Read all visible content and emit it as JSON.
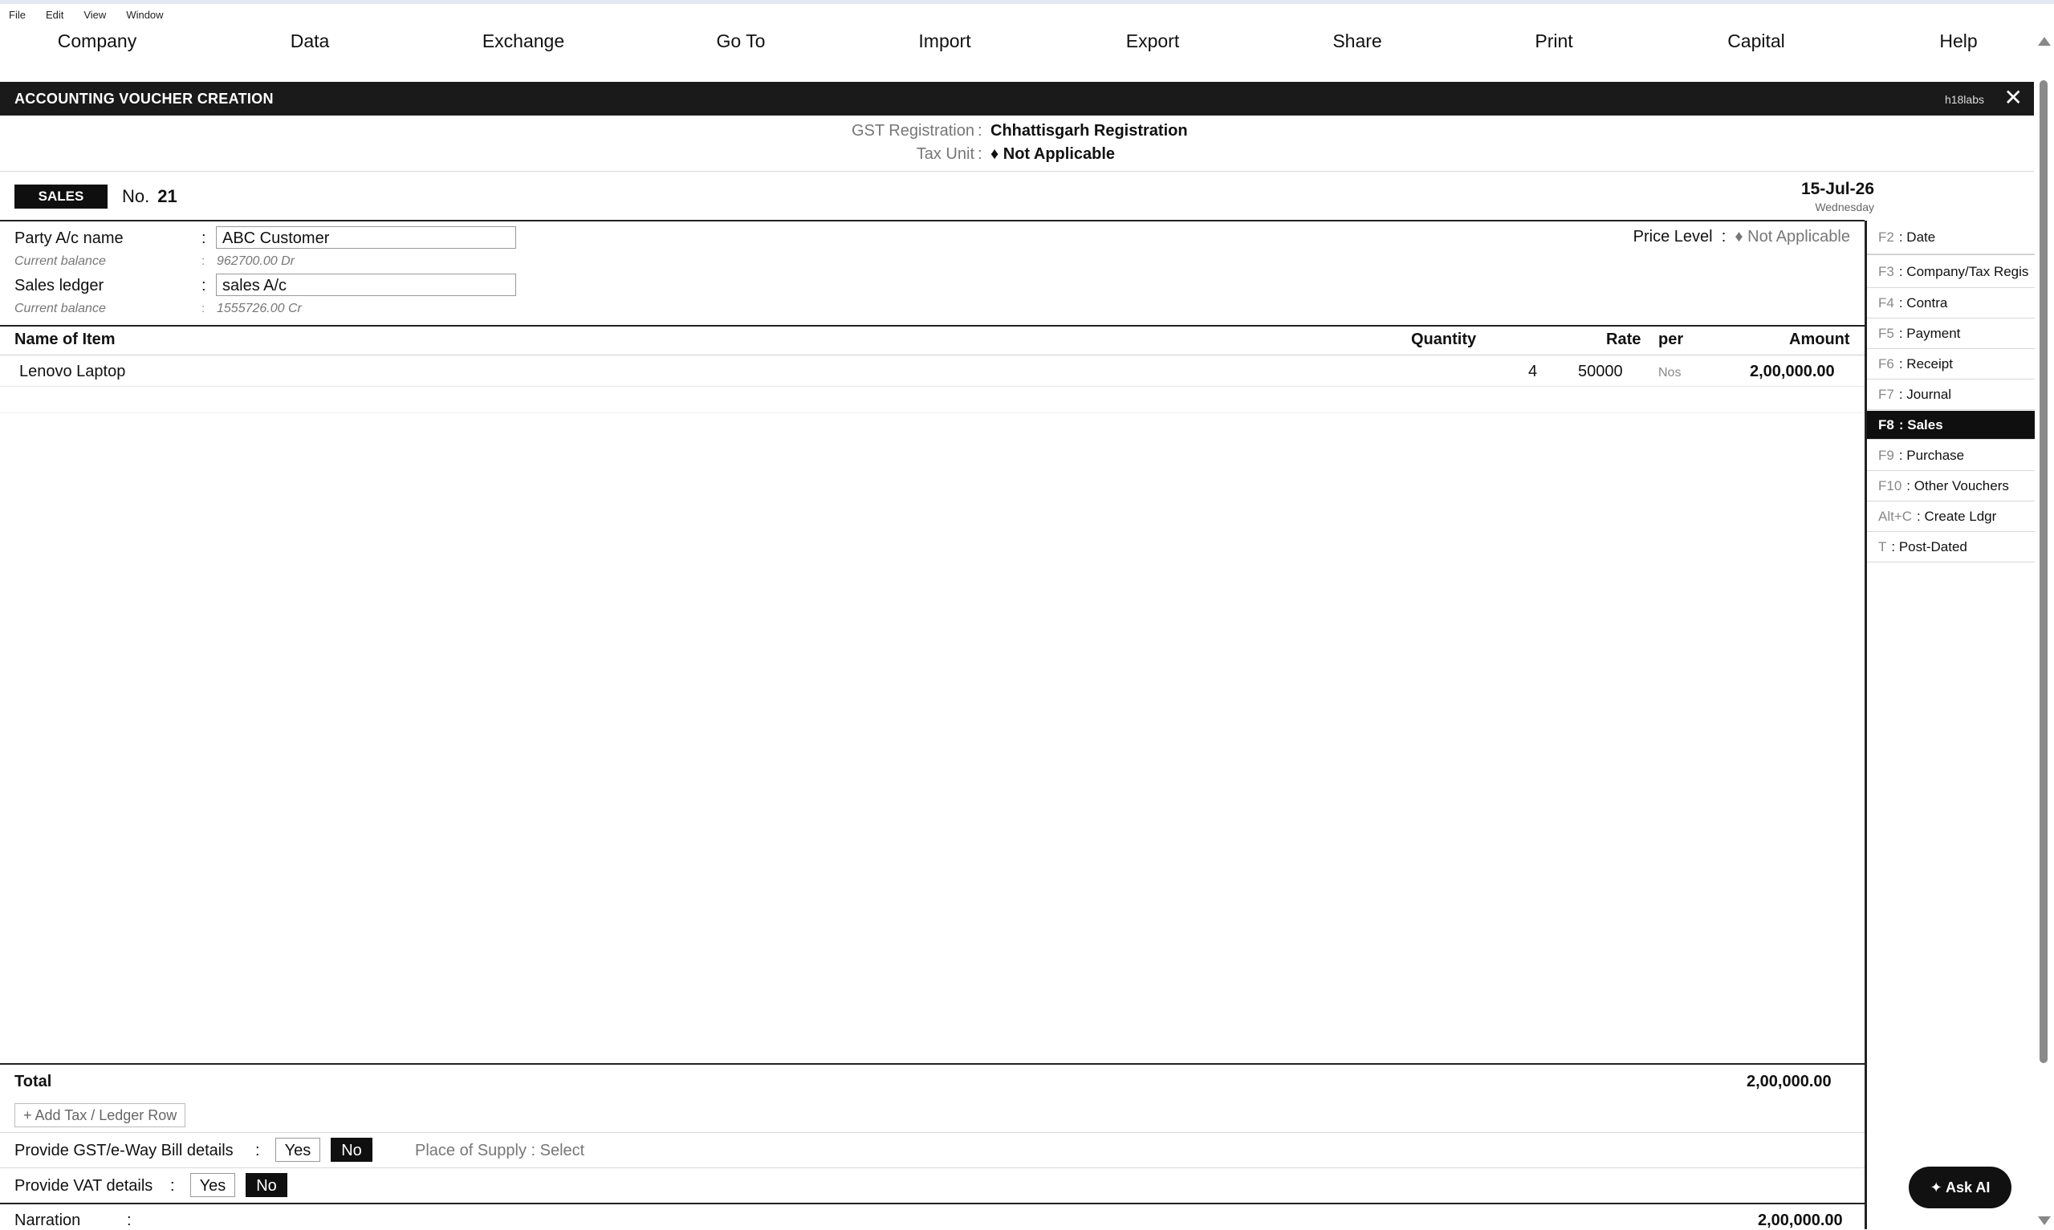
{
  "system_menu": [
    "File",
    "Edit",
    "View",
    "Window"
  ],
  "main_menu": [
    "Company",
    "Data",
    "Exchange",
    "Go To",
    "Import",
    "Export",
    "Share",
    "Print",
    "Capital",
    "Help"
  ],
  "window": {
    "title": "ACCOUNTING VOUCHER CREATION",
    "user": "h18labs"
  },
  "gst": {
    "registration_label": "GST Registration",
    "registration_value": "Chhattisgarh Registration",
    "tax_unit_label": "Tax Unit",
    "tax_unit_value": "♦ Not Applicable"
  },
  "voucher": {
    "type": "SALES",
    "no_label": "No.",
    "number": "21",
    "date": "15-Jul-26",
    "weekday": "Wednesday"
  },
  "party": {
    "label": "Party A/c name",
    "value": "ABC Customer",
    "balance_label": "Current balance",
    "balance_value": "962700.00 Dr"
  },
  "sales_ledger": {
    "label": "Sales ledger",
    "value": "sales A/c",
    "balance_label": "Current balance",
    "balance_value": "1555726.00 Cr"
  },
  "price_level": {
    "label": "Price Level",
    "value": "♦ Not Applicable"
  },
  "table": {
    "headers": {
      "item": "Name of Item",
      "quantity": "Quantity",
      "rate": "Rate",
      "per": "per",
      "amount": "Amount"
    },
    "rows": [
      {
        "item": "Lenovo Laptop",
        "quantity": "4",
        "rate": "50000",
        "per": "Nos",
        "amount": "2,00,000.00"
      }
    ]
  },
  "total": {
    "label": "Total",
    "value": "2,00,000.00"
  },
  "add_row_label": "+ Add Tax / Ledger Row",
  "gst_details": {
    "label": "Provide GST/e-Way Bill details",
    "yes": "Yes",
    "no": "No",
    "place_of_supply": "Place of Supply : Select"
  },
  "vat_details": {
    "label": "Provide VAT details",
    "yes": "Yes",
    "no": "No"
  },
  "narration": {
    "label": "Narration",
    "value": "2,00,000.00"
  },
  "sidebar": [
    {
      "key": "F2",
      "label": ": Date"
    },
    {
      "key": "F3",
      "label": ": Company/Tax Regis"
    },
    {
      "key": "F4",
      "label": ": Contra"
    },
    {
      "key": "F5",
      "label": ": Payment"
    },
    {
      "key": "F6",
      "label": ": Receipt"
    },
    {
      "key": "F7",
      "label": ": Journal"
    },
    {
      "key": "F8",
      "label": ": Sales"
    },
    {
      "key": "F9",
      "label": ": Purchase"
    },
    {
      "key": "F10",
      "label": ": Other Vouchers"
    },
    {
      "key": "Alt+C",
      "label": ": Create Ldgr"
    },
    {
      "key": "T",
      "label": ": Post-Dated"
    }
  ],
  "ask_ai": "✦ Ask AI"
}
